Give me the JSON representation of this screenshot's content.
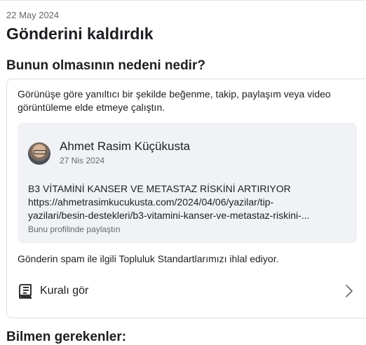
{
  "header": {
    "date": "22 May 2024",
    "title": "Gönderini kaldırdık"
  },
  "reason_section": {
    "title": "Bunun olmasının nedeni nedir?",
    "intro": "Görünüşe göre yanıltıcı bir şekilde beğenme, takip, paylaşım veya video görüntüleme elde etmeye çalıştın.",
    "post": {
      "author": "Ahmet Rasim Küçükusta",
      "date": "27 Nis 2024",
      "text_line1": "B3 VİTAMİNİ KANSER VE METASTAZ RİSKİNİ ARTIRIYOR",
      "text_line2": "https://ahmetrasimkucukusta.com/2024/04/06/yazilar/tip-",
      "text_line3": "yazilari/besin-destekleri/b3-vitamini-kanser-ve-metastaz-riskini-...",
      "shared_note": "Bunu profilinde paylaştın"
    },
    "violation": "Gönderin spam ile ilgili Topluluk Standartlarımızı ihlal ediyor.",
    "rule_link_label": "Kuralı gör"
  },
  "next_section": {
    "title": "Bilmen gerekenler:"
  },
  "icons": {
    "rule": "book-icon",
    "chevron": "chevron-right-icon"
  },
  "colors": {
    "text": "#1c1e21",
    "muted": "#65676b",
    "quote_bg": "#f0f2f5",
    "border": "#dadde1"
  }
}
